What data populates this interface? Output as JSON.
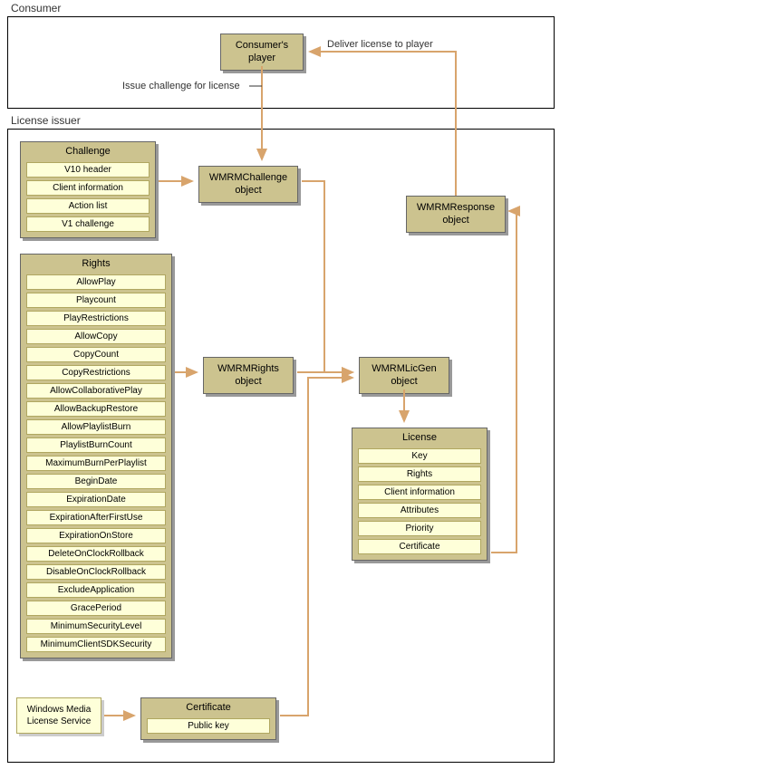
{
  "sections": {
    "consumer": "Consumer",
    "licenseIssuer": "License issuer"
  },
  "consumerPlayer": {
    "line1": "Consumer's",
    "line2": "player"
  },
  "flowLabels": {
    "issueChallenge": "Issue challenge for license",
    "deliverLicense": "Deliver license to player"
  },
  "challenge": {
    "title": "Challenge",
    "items": [
      "V10 header",
      "Client information",
      "Action list",
      "V1 challenge"
    ]
  },
  "wmrmChallenge": {
    "line1": "WMRMChallenge",
    "line2": "object"
  },
  "wmrmResponse": {
    "line1": "WMRMResponse",
    "line2": "object"
  },
  "rights": {
    "title": "Rights",
    "items": [
      "AllowPlay",
      "Playcount",
      "PlayRestrictions",
      "AllowCopy",
      "CopyCount",
      "CopyRestrictions",
      "AllowCollaborativePlay",
      "AllowBackupRestore",
      "AllowPlaylistBurn",
      "PlaylistBurnCount",
      "MaximumBurnPerPlaylist",
      "BeginDate",
      "ExpirationDate",
      "ExpirationAfterFirstUse",
      "ExpirationOnStore",
      "DeleteOnClockRollback",
      "DisableOnClockRollback",
      "ExcludeApplication",
      "GracePeriod",
      "MinimumSecurityLevel",
      "MinimumClientSDKSecurity"
    ]
  },
  "wmrmRights": {
    "line1": "WMRMRights",
    "line2": "object"
  },
  "wmrmLicGen": {
    "line1": "WMRMLicGen",
    "line2": "object"
  },
  "license": {
    "title": "License",
    "items": [
      "Key",
      "Rights",
      "Client information",
      "Attributes",
      "Priority",
      "Certificate"
    ]
  },
  "windowsMedia": {
    "line1": "Windows Media",
    "line2": "License Service"
  },
  "certificate": {
    "title": "Certificate",
    "items": [
      "Public key"
    ]
  }
}
